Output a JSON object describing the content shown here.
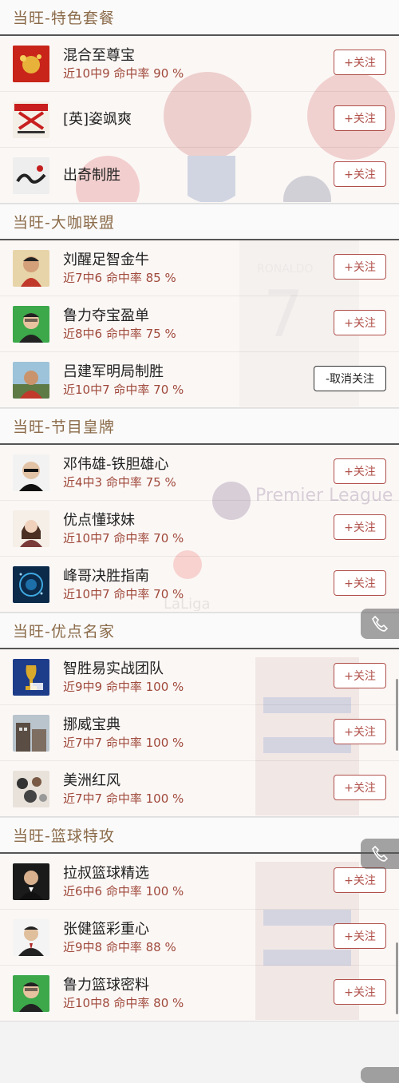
{
  "sections": [
    {
      "title": "当旺-特色套餐",
      "experts": [
        {
          "name": "混合至尊宝",
          "stats": "近10中9 命中率 90 %",
          "action": "+关注"
        },
        {
          "name": "[英]姿飒爽",
          "stats": "",
          "action": "+关注"
        },
        {
          "name": "出奇制胜",
          "stats": "",
          "action": "+关注"
        }
      ]
    },
    {
      "title": "当旺-大咖联盟",
      "experts": [
        {
          "name": "刘醒足智金牛",
          "stats": "近7中6 命中率 85 %",
          "action": "+关注"
        },
        {
          "name": "鲁力夺宝盈单",
          "stats": "近8中6 命中率 75 %",
          "action": "+关注"
        },
        {
          "name": "吕建军明局制胜",
          "stats": "近10中7 命中率 70 %",
          "action": "-取消关注"
        }
      ]
    },
    {
      "title": "当旺-节目皇牌",
      "experts": [
        {
          "name": "邓伟雄-铁胆雄心",
          "stats": "近4中3 命中率 75 %",
          "action": "+关注"
        },
        {
          "name": "优点懂球妹",
          "stats": "近10中7 命中率 70 %",
          "action": "+关注"
        },
        {
          "name": "峰哥决胜指南",
          "stats": "近10中7 命中率 70 %",
          "action": "+关注"
        }
      ]
    },
    {
      "title": "当旺-优点名家",
      "experts": [
        {
          "name": "智胜易实战团队",
          "stats": "近9中9 命中率 100 %",
          "action": "+关注"
        },
        {
          "name": "挪威宝典",
          "stats": "近7中7 命中率 100 %",
          "action": "+关注"
        },
        {
          "name": "美洲红风",
          "stats": "近7中7 命中率 100 %",
          "action": "+关注"
        }
      ]
    },
    {
      "title": "当旺-篮球特攻",
      "experts": [
        {
          "name": "拉叔篮球精选",
          "stats": "近6中6 命中率 100 %",
          "action": "+关注"
        },
        {
          "name": "张健篮彩重心",
          "stats": "近9中8 命中率 88 %",
          "action": "+关注"
        },
        {
          "name": "鲁力篮球密料",
          "stats": "近10中8 命中率 80 %",
          "action": "+关注"
        }
      ]
    }
  ],
  "background_marks": {
    "premier_league": "Premier League",
    "laliga": "LaLiga",
    "jersey_name": "RONALDO"
  },
  "colors": {
    "header_text": "#8b6b4a",
    "stats_text": "#a04a3c",
    "follow_border": "#b0504a"
  }
}
